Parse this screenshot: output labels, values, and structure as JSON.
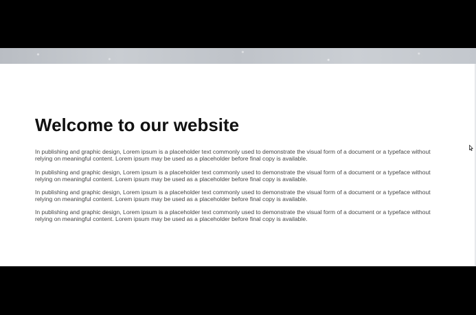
{
  "page": {
    "title": "Welcome to our website",
    "paragraphs": [
      "In publishing and graphic design, Lorem ipsum is a placeholder text commonly used to demonstrate the visual form of a document or a typeface without relying on meaningful content. Lorem ipsum may be used as a placeholder before final copy is available.",
      "In publishing and graphic design, Lorem ipsum is a placeholder text commonly used to demonstrate the visual form of a document or a typeface without relying on meaningful content. Lorem ipsum may be used as a placeholder before final copy is available.",
      "In publishing and graphic design, Lorem ipsum is a placeholder text commonly used to demonstrate the visual form of a document or a typeface without relying on meaningful content. Lorem ipsum may be used as a placeholder before final copy is available.",
      "In publishing and graphic design, Lorem ipsum is a placeholder text commonly used to demonstrate the visual form of a document or a typeface without relying on meaningful content. Lorem ipsum may be used as a placeholder before final copy is available."
    ]
  },
  "icons": {
    "cursor": "mouse-pointer-icon"
  },
  "colors": {
    "background": "#ffffff",
    "letterbox": "#000000",
    "title": "#111111",
    "body_text": "#444444",
    "hero_strip": "#c3c7cd"
  }
}
